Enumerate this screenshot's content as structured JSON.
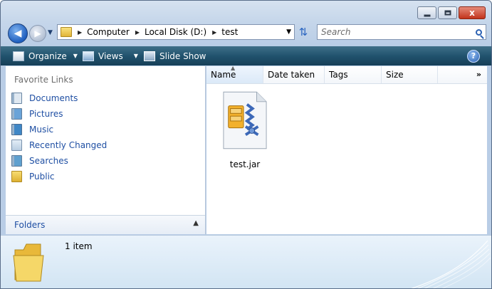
{
  "window": {
    "controls": {
      "minimize": "minimize",
      "maximize": "maximize",
      "close": "x"
    }
  },
  "address": {
    "crumbs": [
      "Computer",
      "Local Disk (D:)",
      "test"
    ]
  },
  "search": {
    "placeholder": "Search"
  },
  "toolbar": {
    "organize": "Organize",
    "views": "Views",
    "slideshow": "Slide Show",
    "help": "?"
  },
  "nav": {
    "title": "Favorite Links",
    "links": [
      {
        "label": "Documents",
        "icon": "documents-icon"
      },
      {
        "label": "Pictures",
        "icon": "pictures-icon"
      },
      {
        "label": "Music",
        "icon": "music-icon"
      },
      {
        "label": "Recently Changed",
        "icon": "recently-changed-icon"
      },
      {
        "label": "Searches",
        "icon": "searches-icon"
      },
      {
        "label": "Public",
        "icon": "public-folder-icon"
      }
    ],
    "folders_label": "Folders"
  },
  "columns": [
    "Name",
    "Date taken",
    "Tags",
    "Size"
  ],
  "files": [
    {
      "name": "test.jar",
      "icon": "jar-archive-icon"
    }
  ],
  "details": {
    "count": "1 item"
  },
  "colors": {
    "toolbar": "#21536e",
    "link": "#1f4fa3",
    "close": "#c2331b"
  }
}
